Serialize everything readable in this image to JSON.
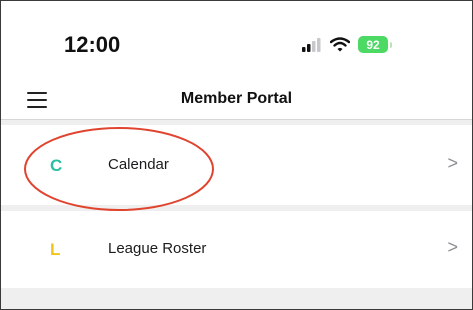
{
  "status_bar": {
    "time": "12:00",
    "battery_level": "92",
    "battery_color": "#4cd964",
    "signal_icon": "cellular-signal-icon",
    "wifi_icon": "wifi-icon"
  },
  "nav": {
    "title": "Member Portal",
    "menu_icon": "hamburger-menu-icon"
  },
  "menu_items": [
    {
      "letter": "C",
      "label": "Calendar",
      "letter_color": "#2bbfa4",
      "highlighted": true
    },
    {
      "letter": "L",
      "label": "League Roster",
      "letter_color": "#f0c419",
      "highlighted": false
    }
  ],
  "chevron_glyph": ">",
  "highlight_color": "#e0442f"
}
